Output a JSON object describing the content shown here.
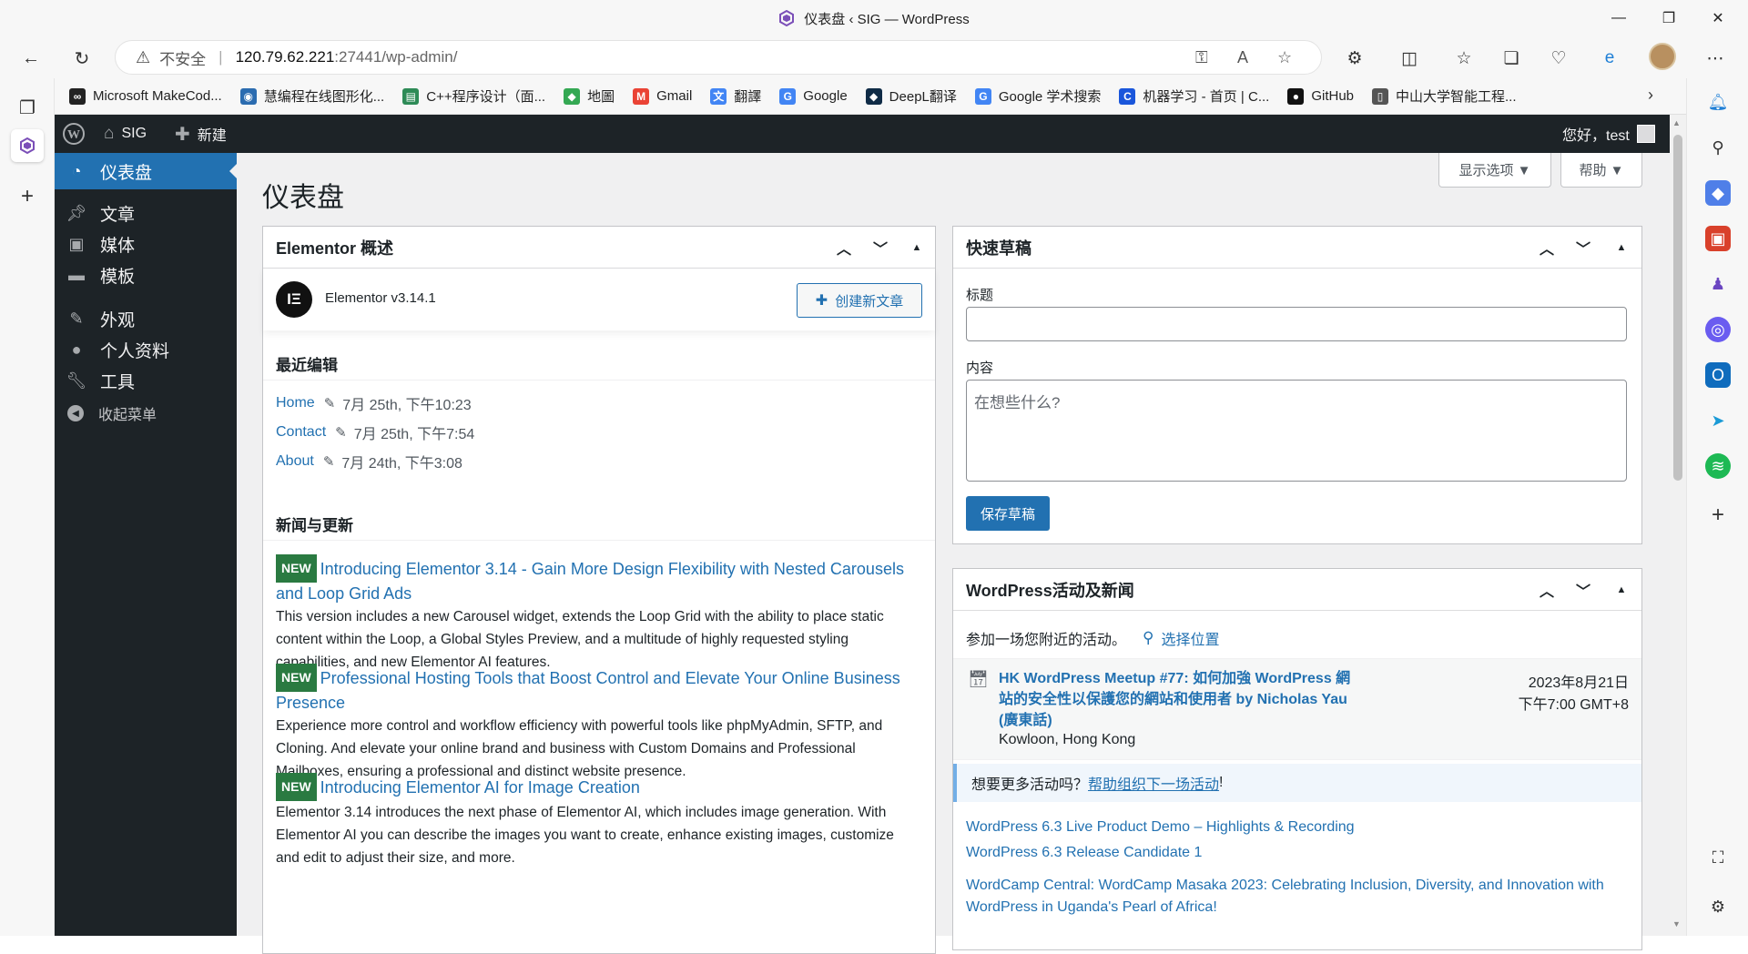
{
  "browser": {
    "window_title": "仪表盘 ‹ SIG — WordPress",
    "insecure_label": "不安全",
    "url_host": "120.79.62.221",
    "url_path": ":27441/wp-admin/",
    "bookmarks": [
      {
        "label": "Microsoft MakeCod...",
        "icon": "infinity-icon",
        "color": "#222222"
      },
      {
        "label": "慧编程在线图形化...",
        "icon": "mblock-icon",
        "color": "#2b6cb0"
      },
      {
        "label": "C++程序设计（面...",
        "icon": "book-icon",
        "color": "#2e8b57"
      },
      {
        "label": "地圖",
        "icon": "maps-icon",
        "color": "#34a853"
      },
      {
        "label": "Gmail",
        "icon": "gmail-icon",
        "color": "#ea4335"
      },
      {
        "label": "翻譯",
        "icon": "translate-icon",
        "color": "#4285f4"
      },
      {
        "label": "Google",
        "icon": "google-icon",
        "color": "#4285f4"
      },
      {
        "label": "DeepL翻译",
        "icon": "deepl-icon",
        "color": "#0f2b46"
      },
      {
        "label": "Google 学术搜索",
        "icon": "google-icon",
        "color": "#4285f4"
      },
      {
        "label": "机器学习 - 首页 | C...",
        "icon": "c-icon",
        "color": "#1a56db"
      },
      {
        "label": "GitHub",
        "icon": "github-icon",
        "color": "#111111"
      },
      {
        "label": "中山大学智能工程...",
        "icon": "page-icon",
        "color": "#555555"
      }
    ]
  },
  "adminbar": {
    "site_name": "SIG",
    "new_label": "新建",
    "greeting": "您好，test"
  },
  "sidebar": {
    "items": [
      {
        "label": "仪表盘",
        "icon": "dashboard-icon"
      },
      {
        "label": "文章",
        "icon": "pin-icon"
      },
      {
        "label": "媒体",
        "icon": "media-icon"
      },
      {
        "label": "模板",
        "icon": "folder-icon"
      },
      {
        "label": "外观",
        "icon": "brush-icon"
      },
      {
        "label": "个人资料",
        "icon": "user-icon"
      },
      {
        "label": "工具",
        "icon": "wrench-icon"
      },
      {
        "label": "收起菜单",
        "icon": "collapse-icon"
      }
    ]
  },
  "page": {
    "title": "仪表盘",
    "screen_options": "显示选项 ▼",
    "help": "帮助 ▼"
  },
  "elementor": {
    "title": "Elementor 概述",
    "version": "Elementor v3.14.1",
    "create_button": "创建新文章",
    "recent_title": "最近编辑",
    "recent": [
      {
        "name": "Home",
        "date": "7月 25th, 下午10:23"
      },
      {
        "name": "Contact",
        "date": "7月 25th, 下午7:54"
      },
      {
        "name": "About",
        "date": "7月 24th, 下午3:08"
      }
    ],
    "news_title": "新闻与更新",
    "badge": "NEW",
    "news": [
      {
        "title": "Introducing Elementor 3.14 - Gain More Design Flexibility with Nested Carousels and Loop Grid Ads",
        "desc": "This version includes a new Carousel widget, extends the Loop Grid with the ability to place static content within the Loop, a Global Styles Preview, and a multitude of highly requested styling capabilities, and new Elementor AI features."
      },
      {
        "title": "Professional Hosting Tools that Boost Control and Elevate Your Online Business Presence",
        "desc": "Experience more control and workflow efficiency with powerful tools like phpMyAdmin, SFTP, and Cloning. And elevate your online brand and business with Custom Domains and Professional Mailboxes, ensuring a professional and distinct website presence."
      },
      {
        "title": "Introducing Elementor AI for Image Creation",
        "desc": "Elementor 3.14 introduces the next phase of Elementor AI, which includes image generation. With Elementor AI you can describe the images you want to create, enhance existing images, customize and edit to adjust their size, and more."
      }
    ]
  },
  "quickdraft": {
    "title": "快速草稿",
    "title_label": "标题",
    "title_value": "",
    "content_label": "内容",
    "content_placeholder": "在想些什么?",
    "save_button": "保存草稿"
  },
  "events": {
    "title": "WordPress活动及新闻",
    "attend_text": "参加一场您附近的活动。",
    "select_location": "选择位置",
    "event_title": "HK WordPress Meetup #77: 如何加強 WordPress 網站的安全性以保護您的網站和使用者 by Nicholas Yau (廣東話)",
    "event_location": "Kowloon, Hong Kong",
    "event_date": "2023年8月21日",
    "event_time": "下午7:00 GMT+8",
    "more_prefix": "想要更多活动吗？",
    "more_link": "帮助组织下一场活动",
    "more_suffix": "!",
    "news": [
      "WordPress 6.3 Live Product Demo – Highlights & Recording",
      "WordPress 6.3 Release Candidate 1",
      "WordCamp Central: WordCamp Masaka 2023: Celebrating Inclusion, Diversity, and Innovation with WordPress in Uganda's Pearl of Africa!"
    ]
  }
}
